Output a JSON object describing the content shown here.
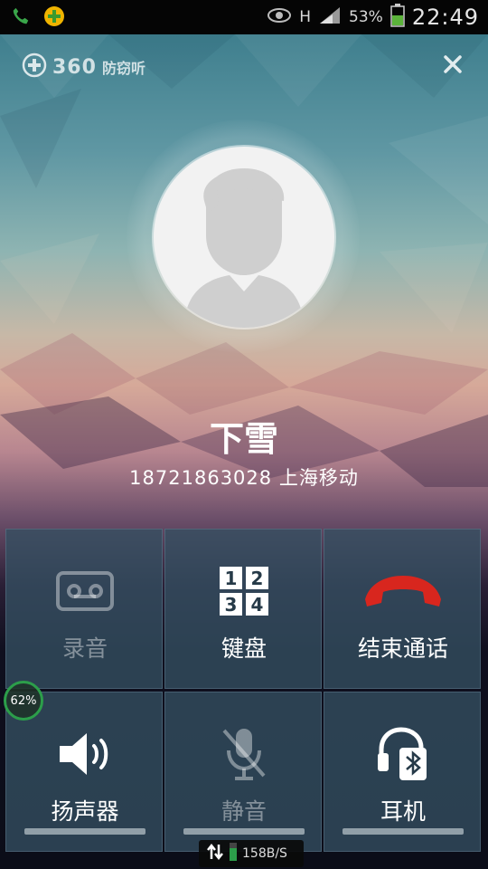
{
  "status_bar": {
    "battery": "53%",
    "time": "22:49",
    "network": "H",
    "icons": [
      "phone-icon",
      "plus-badge-icon",
      "eye-icon",
      "signal-icon",
      "battery-icon"
    ]
  },
  "brand": {
    "logo_text": "360",
    "title": "防窃听"
  },
  "caller": {
    "name": "下雪",
    "number_location": "18721863028 上海移动"
  },
  "controls": [
    {
      "label": "录音",
      "icon": "cassette-icon",
      "enabled": false
    },
    {
      "label": "键盘",
      "icon": "dialpad-icon",
      "enabled": true,
      "digits": [
        "1",
        "2",
        "3",
        "4"
      ]
    },
    {
      "label": "结束通话",
      "icon": "end-call-icon",
      "enabled": true
    },
    {
      "label": "扬声器",
      "icon": "speaker-icon",
      "enabled": true
    },
    {
      "label": "静音",
      "icon": "mute-mic-icon",
      "enabled": false
    },
    {
      "label": "耳机",
      "icon": "bluetooth-headset-icon",
      "enabled": true
    }
  ],
  "overlay_badge": {
    "value": "62%"
  },
  "speed_indicator": {
    "value": "158B/S"
  },
  "colors": {
    "end_call": "#d8261e",
    "badge_ring": "#2c9e4a",
    "tile": "#34506280"
  }
}
